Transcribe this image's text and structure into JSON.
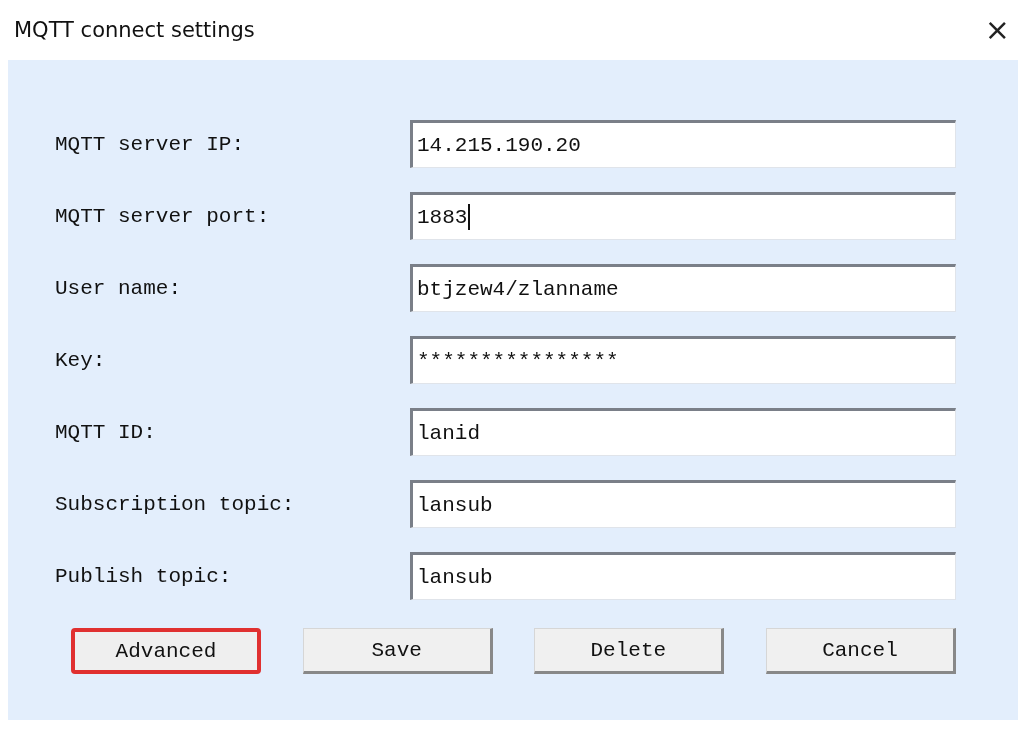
{
  "window": {
    "title": "MQTT connect settings",
    "close": "×"
  },
  "fields": [
    {
      "label": "MQTT server IP:",
      "value": "14.215.190.20",
      "caret": false
    },
    {
      "label": "MQTT server port:",
      "value": "1883",
      "caret": true
    },
    {
      "label": "User name:",
      "value": "btjzew4/zlanname",
      "caret": false
    },
    {
      "label": "Key:",
      "value": "****************",
      "caret": false
    },
    {
      "label": "MQTT ID:",
      "value": "lanid",
      "caret": false
    },
    {
      "label": "Subscription topic:",
      "value": "lansub",
      "caret": false
    },
    {
      "label": "Publish topic:",
      "value": "lansub",
      "caret": false
    }
  ],
  "buttons": [
    {
      "label": "Advanced",
      "highlighted": true
    },
    {
      "label": "Save",
      "highlighted": false
    },
    {
      "label": "Delete",
      "highlighted": false
    },
    {
      "label": "Cancel",
      "highlighted": false
    }
  ]
}
